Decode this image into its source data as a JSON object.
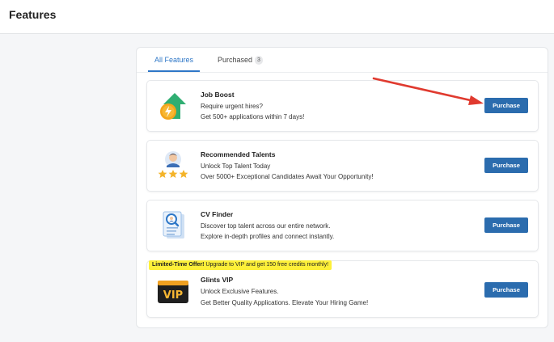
{
  "header": {
    "title": "Features"
  },
  "tabs": [
    {
      "label": "All Features",
      "active": true
    },
    {
      "label": "Purchased",
      "count": "3",
      "active": false
    }
  ],
  "cards": [
    {
      "title": "Job Boost",
      "line1": "Require urgent hires?",
      "line2": "Get 500+ applications within 7 days!",
      "button": "Purchase",
      "icon": "rocket-boost-icon"
    },
    {
      "title": "Recommended Talents",
      "line1": "Unlock Top Talent Today",
      "line2": "Over 5000+ Exceptional Candidates Await Your Opportunity!",
      "button": "Purchase",
      "icon": "talent-stars-icon"
    },
    {
      "title": "CV Finder",
      "line1": "Discover top talent across our entire network.",
      "line2": "Explore in-depth profiles and connect instantly.",
      "button": "Purchase",
      "icon": "cv-search-icon"
    },
    {
      "title": "Glints VIP",
      "line1": "Unlock Exclusive Features.",
      "line2": "Get Better Quality Applications. Elevate Your Hiring Game!",
      "button": "Purchase",
      "icon": "vip-badge-icon",
      "promo": {
        "bold": "Limited-Time Offer!",
        "text": " Upgrade to VIP and get 150 free credits monthly!"
      }
    }
  ],
  "colors": {
    "accent": "#2e77c7",
    "button": "#2b6cae",
    "promo": "#fdf039",
    "arrow": "#e03a2f"
  }
}
